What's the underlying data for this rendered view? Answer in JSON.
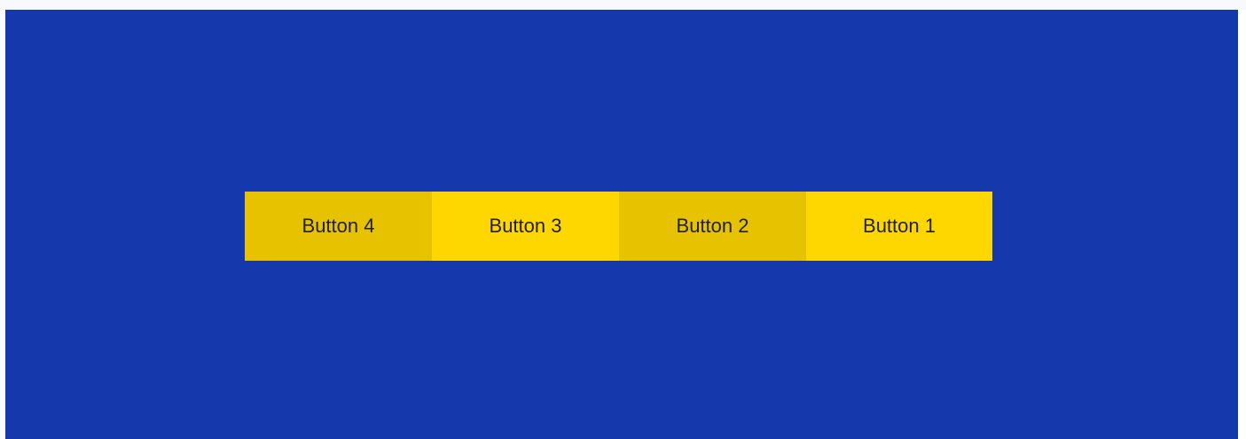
{
  "buttons": [
    {
      "label": "Button 4",
      "color": "#e6c200"
    },
    {
      "label": "Button 3",
      "color": "#ffd700"
    },
    {
      "label": "Button 2",
      "color": "#e6c200"
    },
    {
      "label": "Button 1",
      "color": "#ffd700"
    }
  ],
  "colors": {
    "stage_background": "#1539ad",
    "button_dark": "#e6c200",
    "button_light": "#ffd700",
    "text": "#1f1f1f"
  }
}
